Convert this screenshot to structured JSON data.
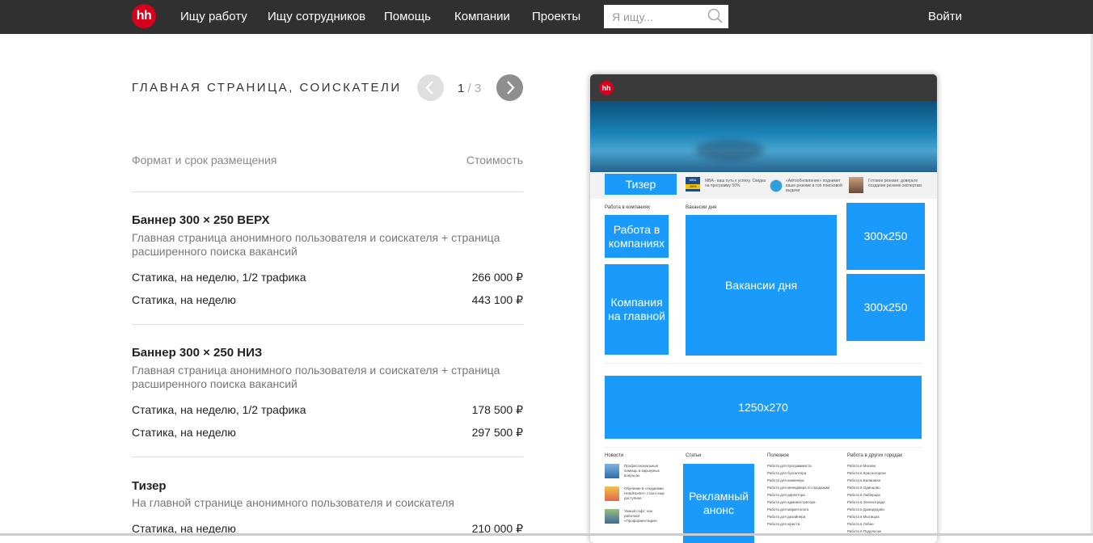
{
  "nav": {
    "logo": "hh",
    "links": [
      "Ищу работу",
      "Ищу сотрудников",
      "Помощь",
      "Компании",
      "Проекты"
    ],
    "search_placeholder": "Я ищу...",
    "login": "Войти"
  },
  "page": {
    "title": "ГЛАВНАЯ СТРАНИЦА, СОИСКАТЕЛИ",
    "pager_current": "1",
    "pager_total": "/ 3",
    "col_format": "Формат и срок размещения",
    "col_price": "Стоимость"
  },
  "sections": [
    {
      "title": "Баннер 300 × 250 ВЕРХ",
      "desc": "Главная страница анонимного пользователя и соискателя + страница расширенного поиска вакансий",
      "rows": [
        {
          "label": "Статика, на неделю, 1/2 трафика",
          "price": "266 000 ₽"
        },
        {
          "label": "Статика, на неделю",
          "price": "443 100 ₽"
        }
      ]
    },
    {
      "title": "Баннер 300 × 250 НИЗ",
      "desc": "Главная страница анонимного пользователя и соискателя + страница расширенного поиска вакансий",
      "rows": [
        {
          "label": "Статика, на неделю, 1/2 трафика",
          "price": "178 500 ₽"
        },
        {
          "label": "Статика, на неделю",
          "price": "297 500 ₽"
        }
      ]
    },
    {
      "title": "Тизер",
      "desc": "На главной странице анонимного пользователя и соискателя",
      "rows": [
        {
          "label": "Статика, на неделю",
          "price": "210 000 ₽"
        }
      ]
    }
  ],
  "preview": {
    "logo": "hh",
    "teaser": "Тизер",
    "teaser_items": [
      "MBA - ваш путь к успеху. Скидка на программу 50%",
      "«Автообновление» поднимет ваше резюме в топ поисковой выдачи",
      "Готовое резюме: доверьте создание резюме экспертам"
    ],
    "mba_badge": "MBA",
    "mba_discount": "-50%",
    "label_companies": "Работа в компаниях",
    "label_vacancies": "Вакансии дня",
    "block_companies": "Работа в компаниях",
    "block_company_main": "Компания на главной",
    "block_vacancies": "Вакансии дня",
    "block_300a": "300x250",
    "block_300b": "300x250",
    "block_wide": "1250x270",
    "col_news": "Новости",
    "col_articles": "Статьи",
    "col_useful": "Полезное",
    "col_cities": "Работа в других городах",
    "block_promo": "Рекламный анонс",
    "news": [
      "Профессиональные помощь в карьерных вопросах",
      "Обучение в «Академии HeadHunter» стало еще доступнее",
      "Умный софт: как работают «Профориентация»"
    ],
    "useful": [
      "Работа для программиста",
      "Работа для бухгалтера",
      "Работа для инженера",
      "Работа для менеджера по продажам",
      "Работа для директора",
      "Работа для администратора",
      "Работа для маркетолога",
      "Работа для дизайнера",
      "Работа для юриста"
    ],
    "cities": [
      "Работа в Москве",
      "Работа в Красногорске",
      "Работа в Балашихе",
      "Работа в Одинцово",
      "Работа в Люберцах",
      "Работа в Зеленограде",
      "Работа в Домодедово",
      "Работа в Мытищах",
      "Работа в Лобне",
      "Работа в Подольске"
    ]
  }
}
